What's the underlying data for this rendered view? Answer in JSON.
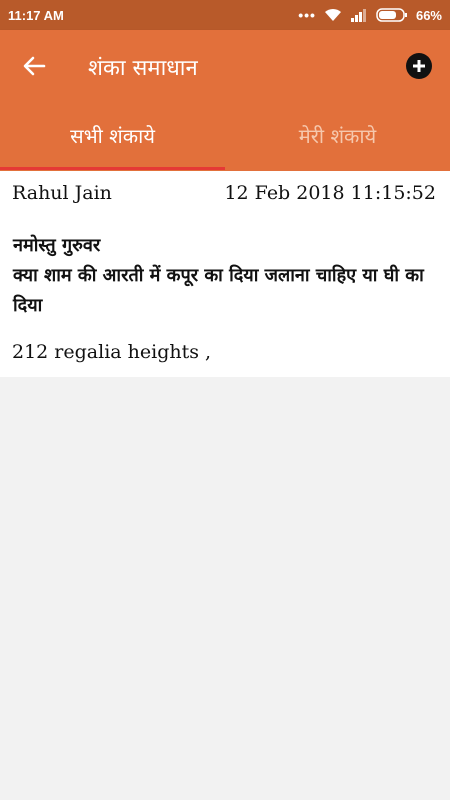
{
  "status_bar": {
    "time": "11:17 AM",
    "battery": "66%",
    "icons": [
      "dots-icon",
      "wifi-icon",
      "signal-icon",
      "battery-icon"
    ]
  },
  "app_bar": {
    "title": "शंका समाधान",
    "back_icon": "arrow-left-icon",
    "add_icon": "plus-circle-icon"
  },
  "tabs": [
    {
      "label": "सभी शंकाये",
      "active": true
    },
    {
      "label": "मेरी शंकाये",
      "active": false
    }
  ],
  "posts": [
    {
      "author": "Rahul Jain",
      "date": "12 Feb 2018 11:15:52",
      "question_line1": "नमोस्तु गुरुवर",
      "question_line2": "क्या शाम की आरती में कपूर का दिया जलाना चाहिए या घी का दिया",
      "address": "212 regalia heights ,"
    }
  ],
  "colors": {
    "status_bar": "#b85a2a",
    "app_bar": "#e2703b",
    "tab_indicator": "#e53935",
    "inactive_tab_text": "#f6c8ad",
    "background": "#f2f2f2"
  }
}
